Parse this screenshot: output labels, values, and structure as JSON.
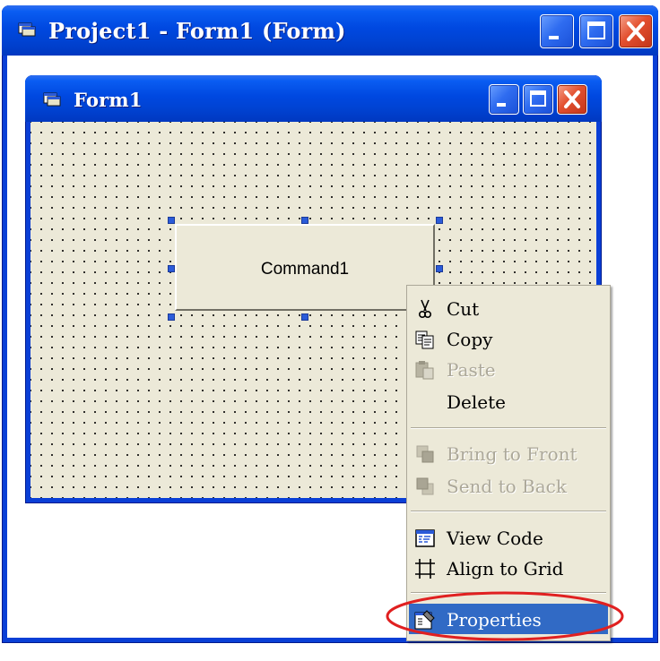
{
  "outer_window": {
    "title": "Project1 - Form1 (Form)"
  },
  "form_window": {
    "title": "Form1"
  },
  "command_button": {
    "caption": "Command1"
  },
  "context_menu": {
    "items": [
      {
        "label": "Cut",
        "icon": "scissors-icon",
        "enabled": true
      },
      {
        "label": "Copy",
        "icon": "copy-icon",
        "enabled": true
      },
      {
        "label": "Paste",
        "icon": "paste-icon",
        "enabled": false
      },
      {
        "label": "Delete",
        "icon": "",
        "enabled": true
      },
      {
        "label": "Bring to Front",
        "icon": "bring-to-front-icon",
        "enabled": false
      },
      {
        "label": "Send to Back",
        "icon": "send-to-back-icon",
        "enabled": false
      },
      {
        "label": "View Code",
        "icon": "view-code-icon",
        "enabled": true
      },
      {
        "label": "Align to Grid",
        "icon": "align-grid-icon",
        "enabled": true
      },
      {
        "label": "Properties",
        "icon": "properties-icon",
        "enabled": true,
        "highlighted": true
      }
    ]
  },
  "colors": {
    "titlebar_blue": "#0048e0",
    "form_face": "#ece9d8",
    "menu_highlight": "#316ac5",
    "annotation_ring": "#e02020",
    "close_button": "#e3502f"
  }
}
